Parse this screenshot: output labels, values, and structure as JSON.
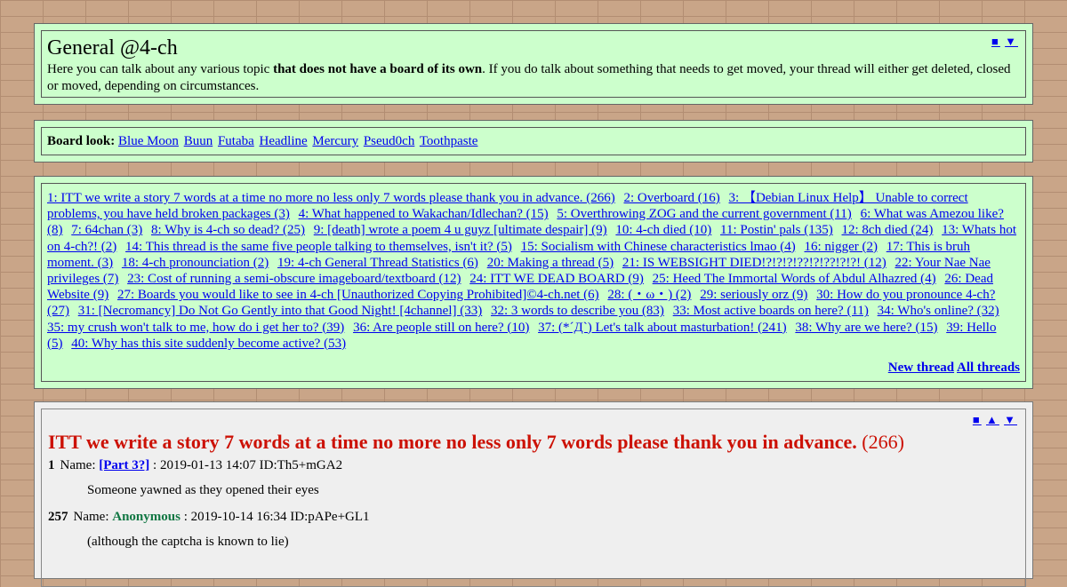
{
  "header": {
    "title": "General @4-ch",
    "desc_pre": "Here you can talk about any various topic ",
    "desc_bold": "that does not have a board of its own",
    "desc_post": ". If you do talk about something that needs to get moved, your thread will either get deleted, closed or moved, depending on circumstances.",
    "nav": [
      "■",
      "▼"
    ]
  },
  "board_look": {
    "label": "Board look:",
    "styles": [
      "Blue Moon",
      "Buun",
      "Futaba",
      "Headline",
      "Mercury",
      "Pseud0ch",
      "Toothpaste"
    ]
  },
  "threads": [
    "1: ITT we write a story 7 words at a time no more no less only 7 words please thank you in advance. (266)",
    "2: Overboard (16)",
    "3: 【Debian Linux Help】 Unable to correct problems, you have held broken packages (3)",
    "4: What happened to Wakachan/Idlechan? (15)",
    "5: Overthrowing ZOG and the current government (11)",
    "6: What was Amezou like? (8)",
    "7: 64chan (3)",
    "8: Why is 4-ch so dead? (25)",
    "9: [death] wrote a poem 4 u guyz [ultimate despair] (9)",
    "10: 4-ch died (10)",
    "11: Postin' pals (135)",
    "12: 8ch died (24)",
    "13: Whats hot on 4-ch?! (2)",
    "14: This thread is the same five people talking to themselves, isn't it? (5)",
    "15: Socialism with Chinese characteristics lmao (4)",
    "16: nigger (2)",
    "17: This is bruh moment. (3)",
    "18: 4-ch pronounciation (2)",
    "19: 4-ch General Thread Statistics (6)",
    "20: Making a thread (5)",
    "21: IS WEBSIGHT DIED!?!?!?!??!?!??!?!?! (12)",
    "22: Your Nae Nae privileges (7)",
    "23: Cost of running a semi-obscure imageboard/textboard (12)",
    "24: ITT WE DEAD BOARD (9)",
    "25: Heed The Immortal Words of Abdul Alhazred (4)",
    "26: Dead Website (9)",
    "27: Boards you would like to see in 4-ch [Unauthorized Copying Prohibited]©4-ch.net (6)",
    "28: (・ω・) (2)",
    "29: seriously orz (9)",
    "30: How do you pronounce 4-ch? (27)",
    "31: [Necromancy] Do Not Go Gently into that Good Night! [4channel] (33)",
    "32: 3 words to describe you (83)",
    "33: Most active boards on here? (11)",
    "34: Who's online? (32)",
    "35: my crush won't talk to me, how do i get her to? (39)",
    "36: Are people still on here? (10)",
    "37: (*´Д`) Let's talk about masturbation! (241)",
    "38: Why are we here? (15)",
    "39: Hello (5)",
    "40: Why has this site suddenly become active? (53)"
  ],
  "thread_actions": {
    "new": "New thread",
    "all": "All threads"
  },
  "thread": {
    "nav": [
      "■",
      "▲",
      "▼"
    ],
    "title": "ITT we write a story 7 words at a time no more no less only 7 words please thank you in advance.",
    "count": "(266)",
    "posts": [
      {
        "num": "1",
        "name_label": "Name:",
        "name": "[Part 3?]",
        "name_is_link": true,
        "meta": ": 2019-01-13 14:07 ID:Th5+mGA2",
        "body": "Someone yawned as they opened their eyes"
      },
      {
        "num": "257",
        "name_label": "Name:",
        "name": "Anonymous",
        "name_is_link": false,
        "meta": ": 2019-10-14 16:34 ID:pAPe+GL1",
        "body": "(although the captcha is known to lie)"
      }
    ]
  }
}
